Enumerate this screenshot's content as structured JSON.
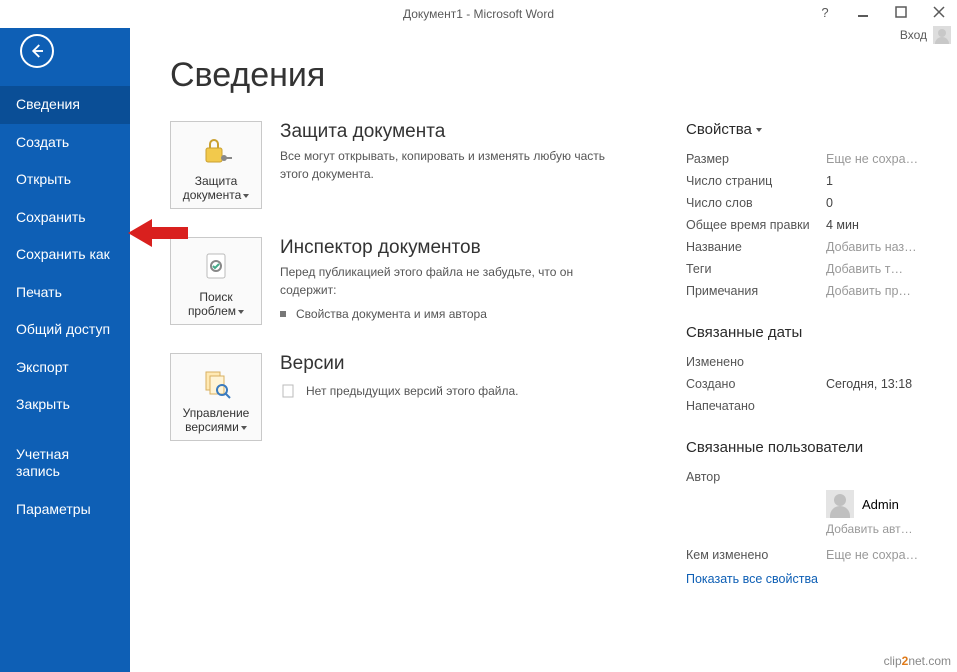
{
  "window": {
    "title": "Документ1 - Microsoft Word",
    "signin": "Вход"
  },
  "sidebar": {
    "items": [
      "Сведения",
      "Создать",
      "Открыть",
      "Сохранить",
      "Сохранить как",
      "Печать",
      "Общий доступ",
      "Экспорт",
      "Закрыть",
      "Учетная запись",
      "Параметры"
    ],
    "active_index": 0
  },
  "page": {
    "heading": "Сведения",
    "protect": {
      "button_label": "Защита документа",
      "title": "Защита документа",
      "desc": "Все могут открывать, копировать и изменять любую часть этого документа."
    },
    "inspect": {
      "button_label": "Поиск проблем",
      "title": "Инспектор документов",
      "desc": "Перед публикацией этого файла не забудьте, что он содержит:",
      "bullet": "Свойства документа и имя автора"
    },
    "versions": {
      "button_label": "Управление версиями",
      "title": "Версии",
      "empty": "Нет предыдущих версий этого файла."
    }
  },
  "props": {
    "heading": "Свойства",
    "rows": {
      "size": {
        "label": "Размер",
        "value": "Еще не сохра…"
      },
      "pages": {
        "label": "Число страниц",
        "value": "1"
      },
      "words": {
        "label": "Число слов",
        "value": "0"
      },
      "edit_time": {
        "label": "Общее время правки",
        "value": "4 мин"
      },
      "title": {
        "label": "Название",
        "value": "Добавить наз…"
      },
      "tags": {
        "label": "Теги",
        "value": "Добавить т…"
      },
      "comments": {
        "label": "Примечания",
        "value": "Добавить пр…"
      }
    },
    "dates_heading": "Связанные даты",
    "dates": {
      "modified": {
        "label": "Изменено",
        "value": ""
      },
      "created": {
        "label": "Создано",
        "value": "Сегодня, 13:18"
      },
      "printed": {
        "label": "Напечатано",
        "value": ""
      }
    },
    "people_heading": "Связанные пользователи",
    "author_label": "Автор",
    "author_name": "Admin",
    "add_author": "Добавить авт…",
    "last_modified_by_label": "Кем изменено",
    "last_modified_by_value": "Еще не сохра…",
    "show_all": "Показать все свойства"
  },
  "watermark": {
    "pre": "clip",
    "mid": "2",
    "post": "net.com"
  }
}
